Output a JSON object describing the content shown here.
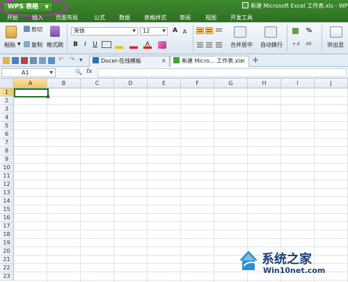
{
  "app": {
    "button_label": "WPS 表格",
    "document_title": "新建 Microsoft Excel 工作表.xls - WPS"
  },
  "menus": [
    "开始",
    "插入",
    "页面布局",
    "公式",
    "数据",
    "表格样式",
    "审阅",
    "视图",
    "开发工具"
  ],
  "ribbon": {
    "paste": "粘贴",
    "cut": "剪切",
    "copy": "复制",
    "format_painter": "格式刷",
    "font_name": "宋体",
    "font_size": "12",
    "grow_font": "A",
    "shrink_font": "A",
    "bold": "B",
    "italic": "I",
    "underline": "U",
    "merge_center": "合并居中",
    "wrap_text": "自动换行",
    "percent": "%",
    "highlight": "突出显"
  },
  "tabs": [
    {
      "label": "Docer-在线模板"
    },
    {
      "label": "新建 Micro... 工作表.xls"
    }
  ],
  "formula_bar": {
    "cell_ref": "A1",
    "fx_label": "fx",
    "value": ""
  },
  "columns": [
    "A",
    "B",
    "C",
    "D",
    "E",
    "F",
    "G",
    "H",
    "I",
    "J"
  ],
  "rows": [
    "1",
    "2",
    "3",
    "4",
    "5",
    "6",
    "7",
    "8",
    "9",
    "10",
    "11",
    "12",
    "13",
    "14",
    "15",
    "16",
    "17",
    "18",
    "19",
    "20",
    "21",
    "22",
    "23"
  ],
  "watermark": {
    "title": "系统之家",
    "url": "Win10net.com"
  },
  "colors": {
    "title_bar": "#3f8a2f",
    "highlight_ring": "#d61cd0",
    "selection": "#1e6e1e",
    "active_header": "#f1c461"
  }
}
